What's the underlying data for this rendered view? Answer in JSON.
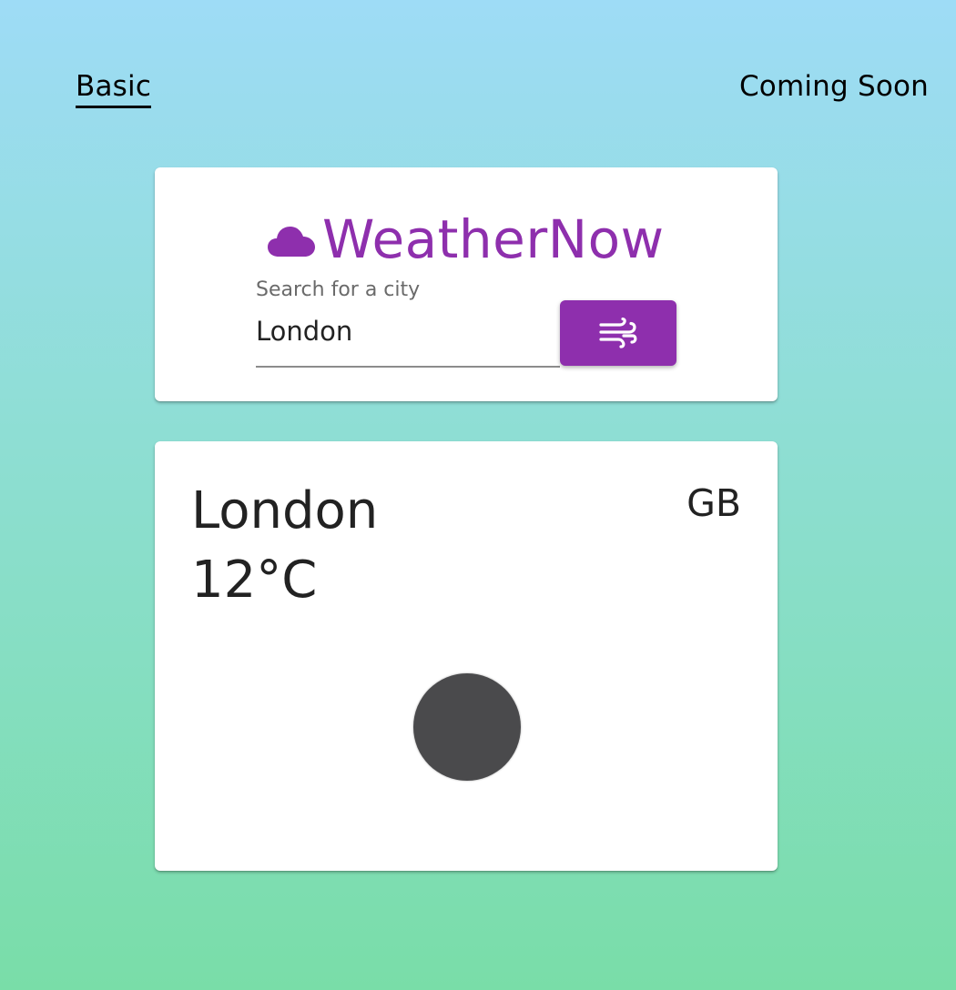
{
  "tabs": {
    "basic": "Basic",
    "coming_soon": "Coming Soon"
  },
  "brand": {
    "name": "WeatherNow",
    "icon": "cloud-icon",
    "color": "#8e2fad"
  },
  "search": {
    "label": "Search for a city",
    "value": "London",
    "button_icon": "wind-icon"
  },
  "result": {
    "city": "London",
    "temperature": "12°C",
    "country": "GB",
    "weather_icon": "weather-status-icon"
  },
  "colors": {
    "accent": "#8e2fad",
    "background_top": "#9edcf6",
    "background_bottom": "#79dda8",
    "icon_fill": "#4a4a4c"
  }
}
